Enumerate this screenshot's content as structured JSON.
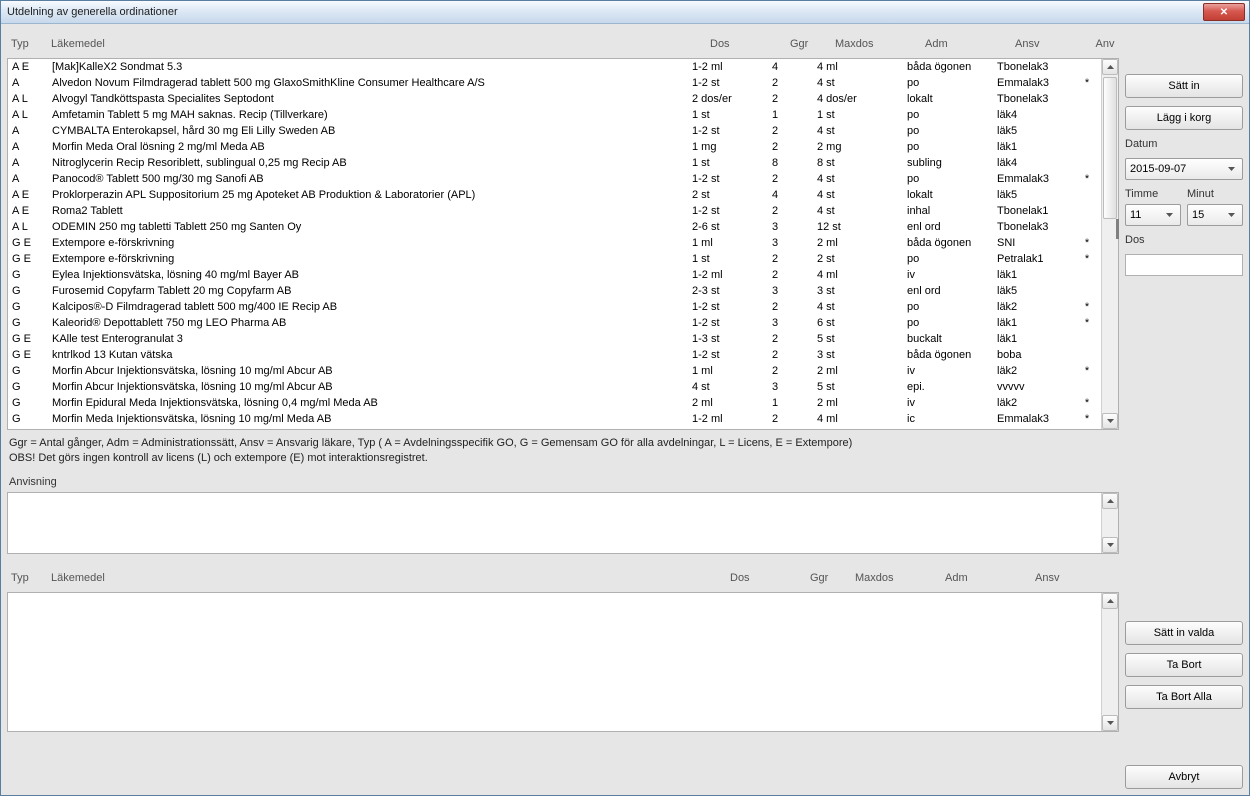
{
  "window": {
    "title": "Utdelning av generella ordinationer"
  },
  "headers": {
    "typ": "Typ",
    "lake": "Läkemedel",
    "dos": "Dos",
    "ggr": "Ggr",
    "max": "Maxdos",
    "adm": "Adm",
    "ansv": "Ansv",
    "anv": "Anv"
  },
  "rows": [
    {
      "typ": "A  E",
      "lake": "[Mak]KalleX2 Sondmat 5.3",
      "dos": "1-2 ml",
      "ggr": "4",
      "max": "4 ml",
      "adm": "båda ögonen",
      "ansv": "Tbonelak3",
      "anv": ""
    },
    {
      "typ": "A",
      "lake": "Alvedon Novum Filmdragerad tablett 500 mg GlaxoSmithKline Consumer Healthcare A/S",
      "dos": "1-2 st",
      "ggr": "2",
      "max": "4 st",
      "adm": "po",
      "ansv": "Emmalak3",
      "anv": "*"
    },
    {
      "typ": "A  L",
      "lake": "Alvogyl Tandköttspasta Specialites Septodont",
      "dos": "2 dos/er",
      "ggr": "2",
      "max": "4 dos/er",
      "adm": "lokalt",
      "ansv": "Tbonelak3",
      "anv": ""
    },
    {
      "typ": "A  L",
      "lake": "Amfetamin Tablett 5 mg MAH saknas. Recip (Tillverkare)",
      "dos": "1 st",
      "ggr": "1",
      "max": "1 st",
      "adm": "po",
      "ansv": "läk4",
      "anv": ""
    },
    {
      "typ": "A",
      "lake": "CYMBALTA Enterokapsel, hård 30 mg Eli Lilly Sweden AB",
      "dos": "1-2 st",
      "ggr": "2",
      "max": "4 st",
      "adm": "po",
      "ansv": "läk5",
      "anv": ""
    },
    {
      "typ": "A",
      "lake": "Morfin Meda Oral lösning 2 mg/ml Meda AB",
      "dos": "1 mg",
      "ggr": "2",
      "max": "2 mg",
      "adm": "po",
      "ansv": "läk1",
      "anv": ""
    },
    {
      "typ": "A",
      "lake": "Nitroglycerin Recip Resoriblett, sublingual 0,25 mg Recip AB",
      "dos": "1 st",
      "ggr": "8",
      "max": "8 st",
      "adm": "subling",
      "ansv": "läk4",
      "anv": ""
    },
    {
      "typ": "A",
      "lake": "Panocod® Tablett 500 mg/30 mg Sanofi AB",
      "dos": "1-2 st",
      "ggr": "2",
      "max": "4 st",
      "adm": "po",
      "ansv": "Emmalak3",
      "anv": "*"
    },
    {
      "typ": "A  E",
      "lake": "Proklorperazin APL Suppositorium 25 mg Apoteket AB Produktion & Laboratorier (APL)",
      "dos": "2 st",
      "ggr": "4",
      "max": "4 st",
      "adm": "lokalt",
      "ansv": "läk5",
      "anv": ""
    },
    {
      "typ": "A  E",
      "lake": "Roma2 Tablett",
      "dos": "1-2 st",
      "ggr": "2",
      "max": "4 st",
      "adm": "inhal",
      "ansv": "Tbonelak1",
      "anv": ""
    },
    {
      "typ": "A  L",
      "lake": "ODEMIN 250 mg tabletti Tablett 250 mg Santen Oy",
      "dos": "2-6 st",
      "ggr": "3",
      "max": "12 st",
      "adm": "enl ord",
      "ansv": "Tbonelak3",
      "anv": ""
    },
    {
      "typ": "G  E",
      "lake": "Extempore e-förskrivning",
      "dos": "1 ml",
      "ggr": "3",
      "max": "2 ml",
      "adm": "båda ögonen",
      "ansv": "SNI",
      "anv": "*"
    },
    {
      "typ": "G  E",
      "lake": "Extempore e-förskrivning",
      "dos": "1 st",
      "ggr": "2",
      "max": "2 st",
      "adm": "po",
      "ansv": "Petralak1",
      "anv": "*"
    },
    {
      "typ": "G",
      "lake": "Eylea Injektionsvätska, lösning 40 mg/ml Bayer AB",
      "dos": "1-2 ml",
      "ggr": "2",
      "max": "4 ml",
      "adm": "iv",
      "ansv": "läk1",
      "anv": ""
    },
    {
      "typ": "G",
      "lake": "Furosemid Copyfarm Tablett 20 mg Copyfarm AB",
      "dos": "2-3 st",
      "ggr": "3",
      "max": "3 st",
      "adm": "enl ord",
      "ansv": "läk5",
      "anv": ""
    },
    {
      "typ": "G",
      "lake": "Kalcipos®-D Filmdragerad tablett 500 mg/400 IE Recip AB",
      "dos": "1-2 st",
      "ggr": "2",
      "max": "4 st",
      "adm": "po",
      "ansv": "läk2",
      "anv": "*"
    },
    {
      "typ": "G",
      "lake": "Kaleorid® Depottablett 750 mg LEO Pharma AB",
      "dos": "1-2 st",
      "ggr": "3",
      "max": "6 st",
      "adm": "po",
      "ansv": "läk1",
      "anv": "*"
    },
    {
      "typ": "G  E",
      "lake": "KAlle test Enterogranulat 3",
      "dos": "1-3 st",
      "ggr": "2",
      "max": "5 st",
      "adm": "buckalt",
      "ansv": "läk1",
      "anv": ""
    },
    {
      "typ": "G  E",
      "lake": "kntrlkod 13 Kutan vätska",
      "dos": "1-2 st",
      "ggr": "2",
      "max": "3 st",
      "adm": "båda ögonen",
      "ansv": "boba",
      "anv": ""
    },
    {
      "typ": "G",
      "lake": "Morfin Abcur Injektionsvätska, lösning 10 mg/ml Abcur AB",
      "dos": "1 ml",
      "ggr": "2",
      "max": "2 ml",
      "adm": "iv",
      "ansv": "läk2",
      "anv": "*"
    },
    {
      "typ": "G",
      "lake": "Morfin Abcur Injektionsvätska, lösning 10 mg/ml Abcur AB",
      "dos": "4 st",
      "ggr": "3",
      "max": "5 st",
      "adm": "epi.",
      "ansv": "vvvvv",
      "anv": ""
    },
    {
      "typ": "G",
      "lake": "Morfin Epidural Meda Injektionsvätska, lösning 0,4 mg/ml Meda AB",
      "dos": "2 ml",
      "ggr": "1",
      "max": "2 ml",
      "adm": "iv",
      "ansv": "läk2",
      "anv": "*"
    },
    {
      "typ": "G",
      "lake": "Morfin Meda Injektionsvätska, lösning 10 mg/ml Meda AB",
      "dos": "1-2 ml",
      "ggr": "2",
      "max": "4 ml",
      "adm": "ic",
      "ansv": "Emmalak3",
      "anv": "*"
    }
  ],
  "legend1": "Ggr = Antal gånger, Adm = Administrationssätt, Ansv = Ansvarig läkare, Typ ( A = Avdelningsspecifik GO, G = Gemensam GO för alla avdelningar, L = Licens, E = Extempore)",
  "legend2": "OBS! Det görs ingen kontroll av licens (L) och extempore (E) mot interaktionsregistret.",
  "anvisning_label": "Anvisning",
  "headers2": {
    "typ": "Typ",
    "lake": "Läkemedel",
    "dos": "Dos",
    "ggr": "Ggr",
    "max": "Maxdos",
    "adm": "Adm",
    "ansv": "Ansv"
  },
  "sidebar": {
    "satt_in": "Sätt in",
    "lagg_i_korg": "Lägg i korg",
    "datum_label": "Datum",
    "datum_value": "2015-09-07",
    "timme_label": "Timme",
    "minut_label": "Minut",
    "timme_value": "11",
    "minut_value": "15",
    "dos_label": "Dos",
    "satt_in_valda": "Sätt in valda",
    "ta_bort": "Ta Bort",
    "ta_bort_alla": "Ta Bort Alla",
    "avbryt": "Avbryt"
  }
}
